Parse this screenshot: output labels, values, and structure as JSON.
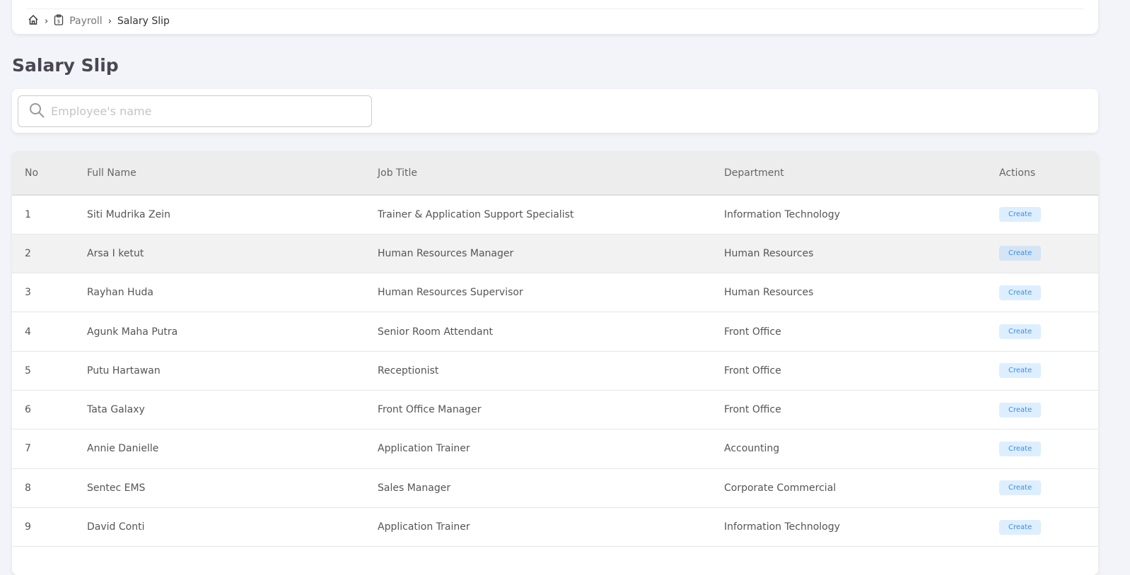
{
  "breadcrumb": {
    "parent": "Payroll",
    "current": "Salary Slip"
  },
  "page_title": "Salary Slip",
  "search": {
    "placeholder": "Employee's name",
    "value": ""
  },
  "table": {
    "headers": [
      "No",
      "Full Name",
      "Job Title",
      "Department",
      "Actions"
    ],
    "rows": [
      {
        "no": "1",
        "name": "Siti Mudrika Zein",
        "job": "Trainer & Application Support Specialist",
        "dept": "Information Technology",
        "action": "Create"
      },
      {
        "no": "2",
        "name": "Arsa I ketut",
        "job": "Human Resources Manager",
        "dept": "Human Resources",
        "action": "Create"
      },
      {
        "no": "3",
        "name": "Rayhan Huda",
        "job": "Human Resources Supervisor",
        "dept": "Human Resources",
        "action": "Create"
      },
      {
        "no": "4",
        "name": "Agunk Maha Putra",
        "job": "Senior Room Attendant",
        "dept": "Front Office",
        "action": "Create"
      },
      {
        "no": "5",
        "name": "Putu Hartawan",
        "job": "Receptionist",
        "dept": "Front Office",
        "action": "Create"
      },
      {
        "no": "6",
        "name": "Tata Galaxy",
        "job": "Front Office Manager",
        "dept": "Front Office",
        "action": "Create"
      },
      {
        "no": "7",
        "name": "Annie Danielle",
        "job": "Application Trainer",
        "dept": "Accounting",
        "action": "Create"
      },
      {
        "no": "8",
        "name": "Sentec EMS",
        "job": "Sales Manager",
        "dept": "Corporate Commercial",
        "action": "Create"
      },
      {
        "no": "9",
        "name": "David Conti",
        "job": "Application Trainer",
        "dept": "Information Technology",
        "action": "Create"
      }
    ]
  }
}
